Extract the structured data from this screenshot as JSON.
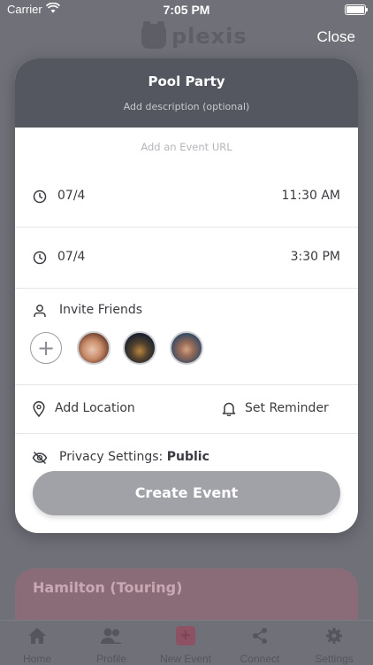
{
  "status_bar": {
    "carrier": "Carrier",
    "time": "7:05 PM"
  },
  "app": {
    "logo_text": "plexis",
    "close_label": "Close"
  },
  "event": {
    "title": "Pool Party",
    "description_placeholder": "Add description (optional)",
    "url_placeholder": "Add an Event URL",
    "start": {
      "date": "07/4",
      "time": "11:30 AM"
    },
    "end": {
      "date": "07/4",
      "time": "3:30 PM"
    },
    "invite_label": "Invite Friends",
    "location_label": "Add Location",
    "reminder_label": "Set Reminder",
    "privacy_label": "Privacy Settings:",
    "privacy_value": "Public",
    "create_label": "Create Event"
  },
  "background_card": {
    "title": "Hamilton (Touring)"
  },
  "tabs": [
    {
      "label": "Home"
    },
    {
      "label": "Profile"
    },
    {
      "label": "New Event"
    },
    {
      "label": "Connect"
    },
    {
      "label": "Settings"
    }
  ],
  "colors": {
    "modal_header": "#545660",
    "create_button": "#a0a2a8",
    "overlay": "#6f7078"
  }
}
